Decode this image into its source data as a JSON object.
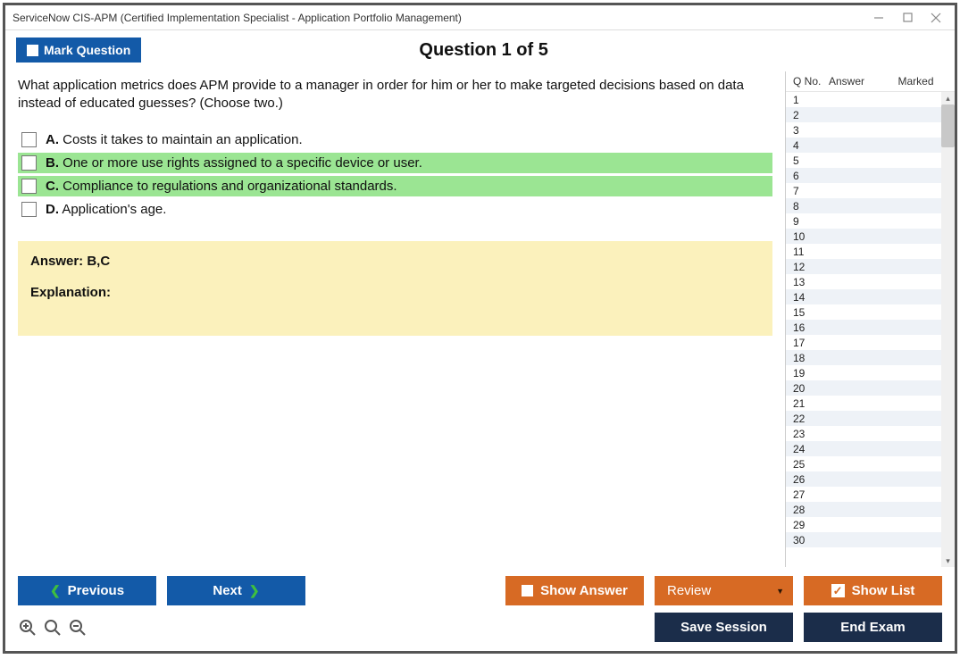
{
  "window": {
    "title": "ServiceNow CIS-APM (Certified Implementation Specialist - Application Portfolio Management)"
  },
  "header": {
    "mark_label": "Mark Question",
    "question_heading": "Question 1 of 5"
  },
  "question": {
    "text": "What application metrics does APM provide to a manager in order for him or her to make targeted decisions based on data instead of educated guesses? (Choose two.)",
    "choices": [
      {
        "letter": "A.",
        "text": "Costs it takes to maintain an application.",
        "highlight": false
      },
      {
        "letter": "B.",
        "text": "One or more use rights assigned to a specific device or user.",
        "highlight": true
      },
      {
        "letter": "C.",
        "text": "Compliance to regulations and organizational standards.",
        "highlight": true
      },
      {
        "letter": "D.",
        "text": "Application's age.",
        "highlight": false
      }
    ]
  },
  "answer_panel": {
    "answer_label": "Answer: B,C",
    "explanation_label": "Explanation:"
  },
  "side": {
    "col_qno": "Q No.",
    "col_answer": "Answer",
    "col_marked": "Marked",
    "rows": [
      1,
      2,
      3,
      4,
      5,
      6,
      7,
      8,
      9,
      10,
      11,
      12,
      13,
      14,
      15,
      16,
      17,
      18,
      19,
      20,
      21,
      22,
      23,
      24,
      25,
      26,
      27,
      28,
      29,
      30
    ]
  },
  "footer": {
    "previous": "Previous",
    "next": "Next",
    "show_answer": "Show Answer",
    "review": "Review",
    "show_list": "Show List",
    "save_session": "Save Session",
    "end_exam": "End Exam"
  }
}
